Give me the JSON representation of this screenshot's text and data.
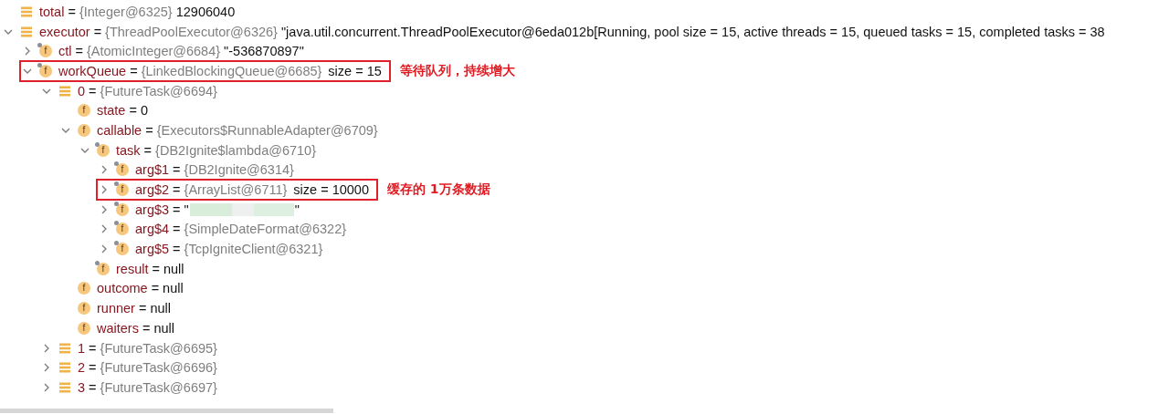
{
  "tree": [
    {
      "name": "total",
      "op": "=",
      "type": "{Integer@6325}",
      "value": "12906040",
      "kind": "list"
    },
    {
      "name": "executor",
      "op": "=",
      "type": "{ThreadPoolExecutor@6326}",
      "value": "\"java.util.concurrent.ThreadPoolExecutor@6eda012b[Running, pool size = 15, active threads = 15, queued tasks = 15, completed tasks = 38",
      "kind": "list",
      "expanded": true,
      "children": [
        {
          "name": "ctl",
          "op": "=",
          "type": "{AtomicInteger@6684}",
          "value": "\"-536870897\"",
          "kind": "field",
          "glyph": "f",
          "marked": true,
          "expanded": false
        },
        {
          "name": "workQueue",
          "op": "=",
          "type": "{LinkedBlockingQueue@6685}",
          "suffix": "size = 15",
          "kind": "field",
          "glyph": "f",
          "marked": true,
          "expanded": true,
          "highlighted": true,
          "note": "等待队列，持续增大",
          "children": [
            {
              "name": "0",
              "op": "=",
              "type": "{FutureTask@6694}",
              "kind": "list",
              "expanded": true,
              "children": [
                {
                  "name": "state",
                  "op": "=",
                  "value": "0",
                  "kind": "field",
                  "glyph": "f",
                  "marked": false
                },
                {
                  "name": "callable",
                  "op": "=",
                  "type": "{Executors$RunnableAdapter@6709}",
                  "kind": "field",
                  "glyph": "f",
                  "marked": false,
                  "expanded": true,
                  "children": [
                    {
                      "name": "task",
                      "op": "=",
                      "type": "{DB2Ignite$lambda@6710}",
                      "kind": "field",
                      "glyph": "f",
                      "marked": true,
                      "expanded": true,
                      "children": [
                        {
                          "name": "arg$1",
                          "op": "=",
                          "type": "{DB2Ignite@6314}",
                          "kind": "field",
                          "glyph": "f",
                          "marked": true,
                          "expanded": false
                        },
                        {
                          "name": "arg$2",
                          "op": "=",
                          "type": "{ArrayList@6711}",
                          "suffix": "size = 10000",
                          "kind": "field",
                          "glyph": "f",
                          "marked": true,
                          "expanded": false,
                          "highlighted": true,
                          "note": "缓存的 1万条数据"
                        },
                        {
                          "name": "arg$3",
                          "op": "=",
                          "value": "\"",
                          "value_end": "\"",
                          "redacted": true,
                          "kind": "field",
                          "glyph": "f",
                          "marked": true,
                          "expanded": false
                        },
                        {
                          "name": "arg$4",
                          "op": "=",
                          "type": "{SimpleDateFormat@6322}",
                          "kind": "field",
                          "glyph": "f",
                          "marked": true,
                          "expanded": false
                        },
                        {
                          "name": "arg$5",
                          "op": "=",
                          "type": "{TcpIgniteClient@6321}",
                          "kind": "field",
                          "glyph": "f",
                          "marked": true,
                          "expanded": false
                        }
                      ]
                    },
                    {
                      "name": "result",
                      "op": "=",
                      "value": "null",
                      "kind": "field",
                      "glyph": "f",
                      "marked": true
                    }
                  ]
                },
                {
                  "name": "outcome",
                  "op": "=",
                  "value": "null",
                  "kind": "field",
                  "glyph": "f",
                  "marked": false
                },
                {
                  "name": "runner",
                  "op": "=",
                  "value": "null",
                  "kind": "field",
                  "glyph": "f",
                  "marked": false
                },
                {
                  "name": "waiters",
                  "op": "=",
                  "value": "null",
                  "kind": "field",
                  "glyph": "f",
                  "marked": false
                }
              ]
            },
            {
              "name": "1",
              "op": "=",
              "type": "{FutureTask@6695}",
              "kind": "list",
              "expanded": false
            },
            {
              "name": "2",
              "op": "=",
              "type": "{FutureTask@6696}",
              "kind": "list",
              "expanded": false
            },
            {
              "name": "3",
              "op": "=",
              "type": "{FutureTask@6697}",
              "kind": "list",
              "expanded": false
            }
          ]
        }
      ]
    }
  ]
}
